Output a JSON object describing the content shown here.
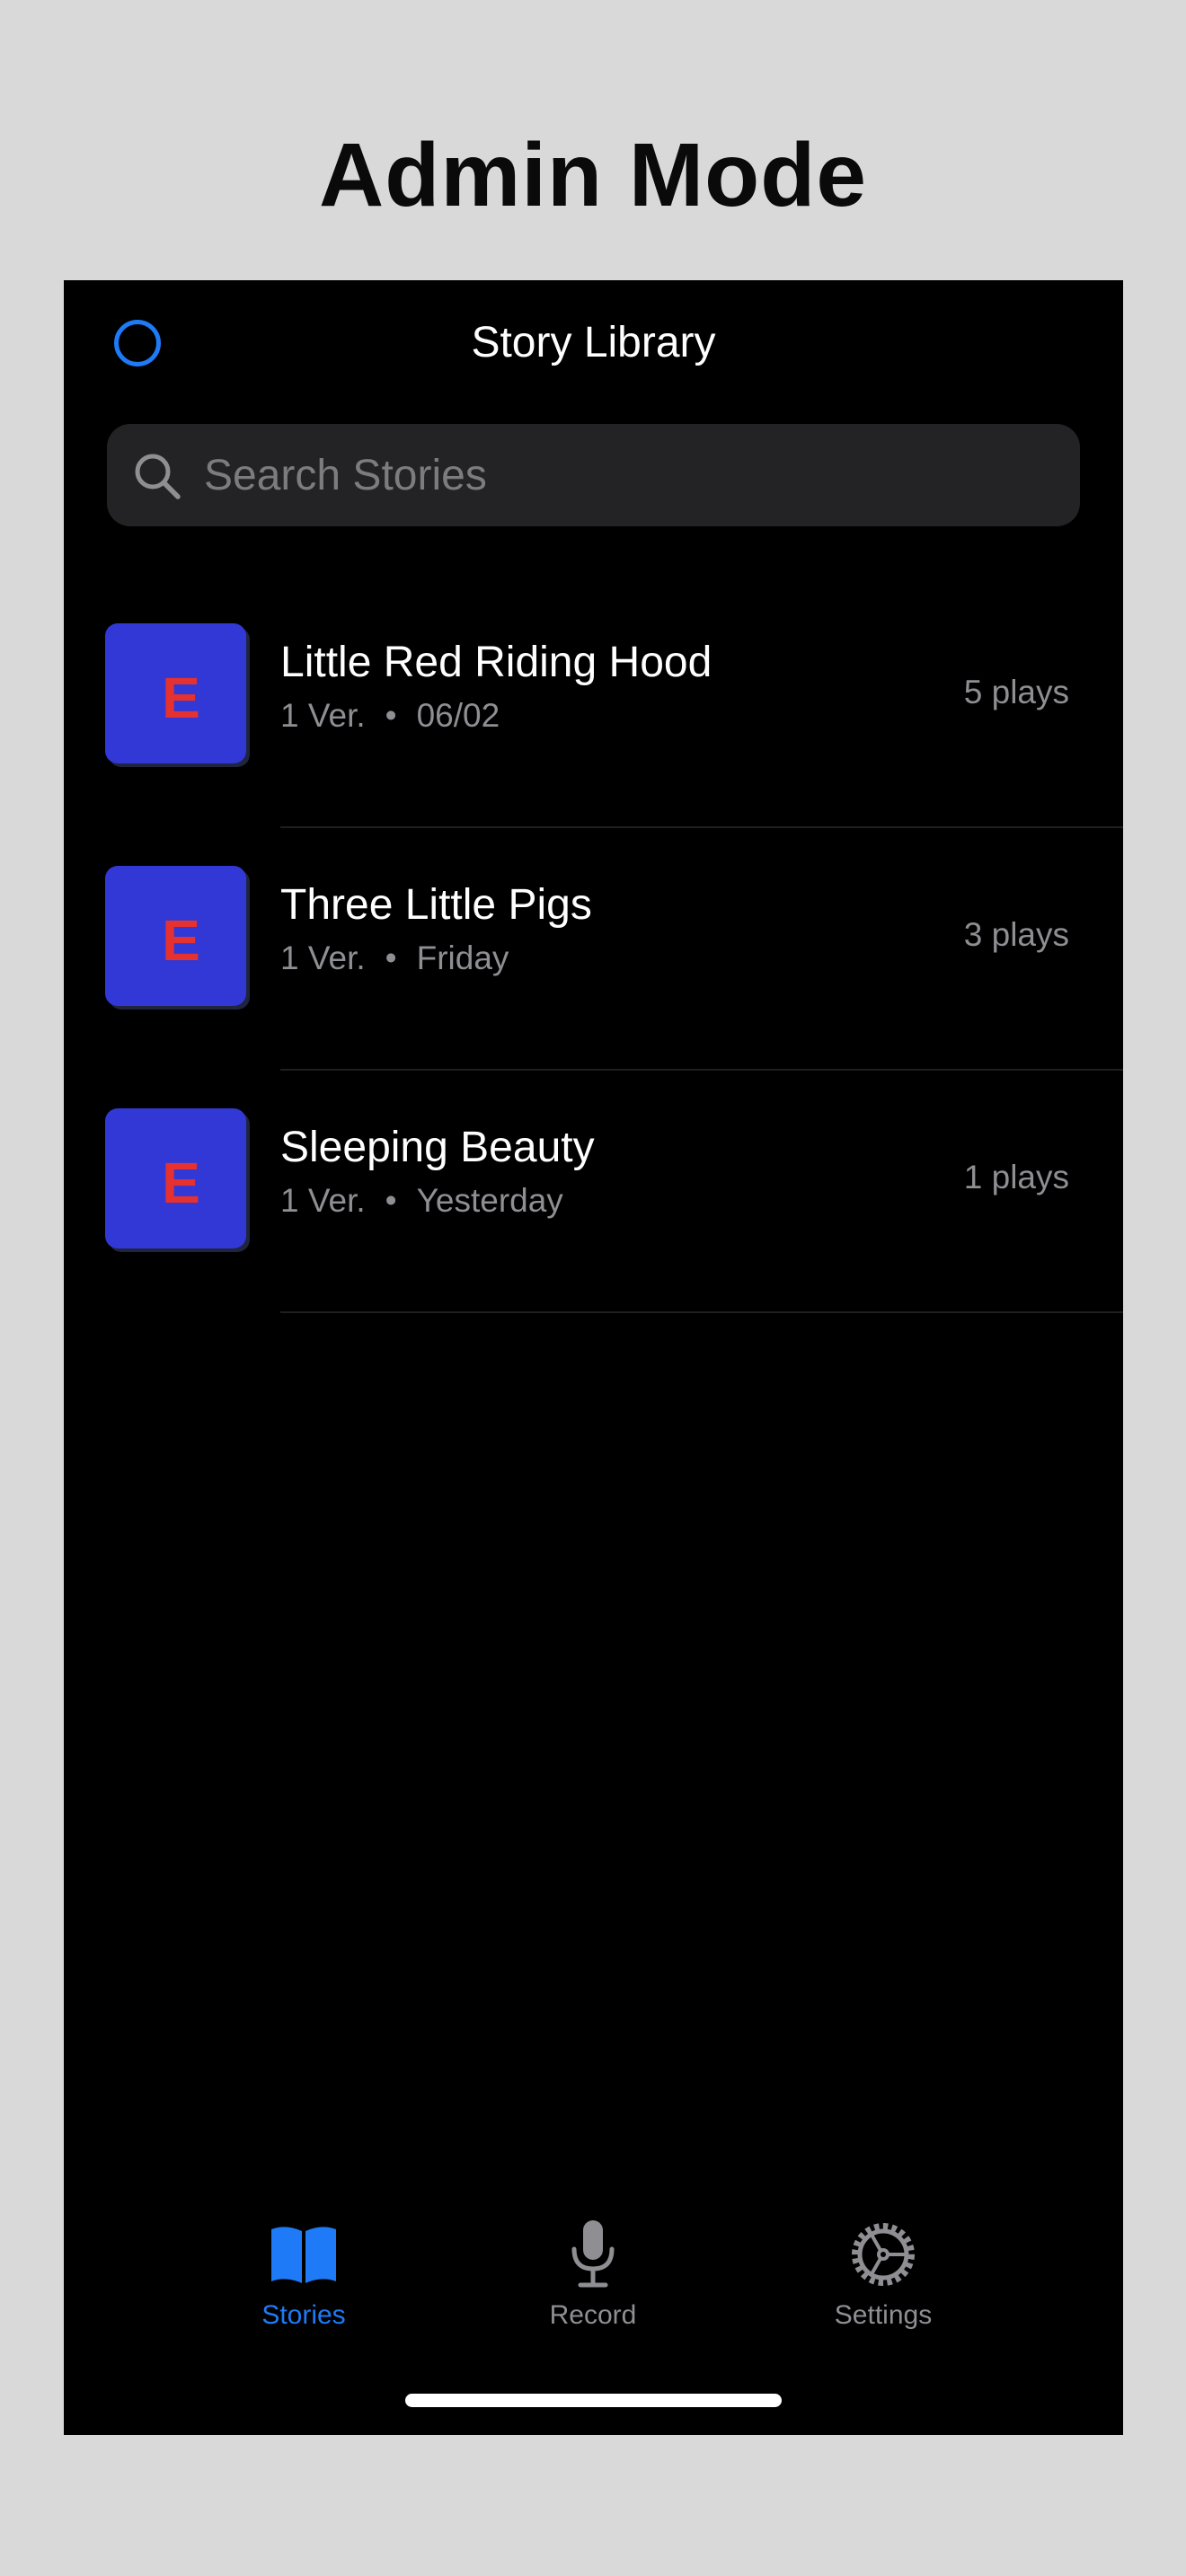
{
  "header": {
    "title": "Admin Mode"
  },
  "nav": {
    "title": "Story Library"
  },
  "search": {
    "placeholder": "Search Stories",
    "value": ""
  },
  "stories": [
    {
      "thumb_letter": "E",
      "title": "Little Red Riding Hood",
      "versions": "1 Ver.",
      "separator": "•",
      "date": "06/02",
      "plays": "5 plays"
    },
    {
      "thumb_letter": "E",
      "title": "Three Little Pigs",
      "versions": "1 Ver.",
      "separator": "•",
      "date": "Friday",
      "plays": "3 plays"
    },
    {
      "thumb_letter": "E",
      "title": "Sleeping Beauty",
      "versions": "1 Ver.",
      "separator": "•",
      "date": "Yesterday",
      "plays": "1 plays"
    }
  ],
  "tabbar": {
    "tabs": [
      {
        "label": "Stories",
        "icon": "book-icon",
        "active": true
      },
      {
        "label": "Record",
        "icon": "microphone-icon",
        "active": false
      },
      {
        "label": "Settings",
        "icon": "gear-icon",
        "active": false
      }
    ]
  },
  "colors": {
    "accent": "#1e7af6",
    "thumb_background": "#3238d6",
    "thumb_letter": "#e5312f",
    "inactive_tab": "#8e8e93",
    "background": "#000000"
  }
}
